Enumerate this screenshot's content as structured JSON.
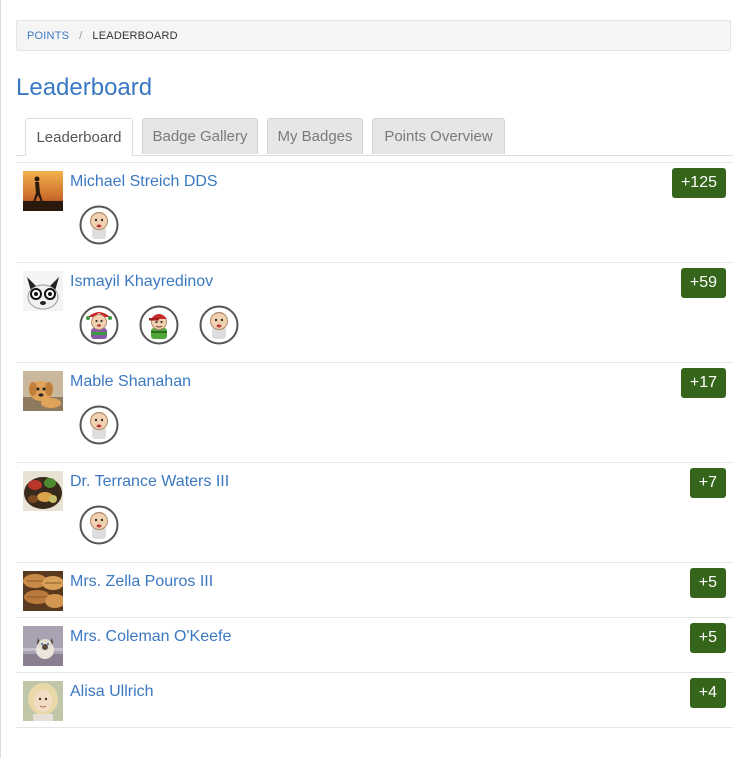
{
  "breadcrumb": {
    "parent": "POINTS",
    "separator": "/",
    "current": "LEADERBOARD"
  },
  "page_title": "Leaderboard",
  "tabs": [
    {
      "label": "Leaderboard",
      "active": true
    },
    {
      "label": "Badge Gallery",
      "active": false
    },
    {
      "label": "My Badges",
      "active": false
    },
    {
      "label": "Points Overview",
      "active": false
    }
  ],
  "colors": {
    "link": "#3b78c2",
    "points_badge": "#35651a"
  },
  "rows": [
    {
      "name": "Michael Streich DDS",
      "points": "+125",
      "avatar_icon": "silhouette-sunset-avatar",
      "badges": [
        "baby-badge-icon"
      ]
    },
    {
      "name": "Ismayil Khayredinov",
      "points": "+59",
      "avatar_icon": "dog-with-glasses-avatar",
      "badges": [
        "jester-badge-icon",
        "cap-kid-badge-icon",
        "baby-badge-icon"
      ]
    },
    {
      "name": "Mable Shanahan",
      "points": "+17",
      "avatar_icon": "puppy-avatar",
      "badges": [
        "baby-badge-icon"
      ]
    },
    {
      "name": "Dr. Terrance Waters III",
      "points": "+7",
      "avatar_icon": "food-plate-avatar",
      "badges": [
        "baby-badge-icon"
      ]
    },
    {
      "name": "Mrs. Zella Pouros III",
      "points": "+5",
      "avatar_icon": "bread-avatar",
      "badges": []
    },
    {
      "name": "Mrs. Coleman O'Keefe",
      "points": "+5",
      "avatar_icon": "siamese-cat-avatar",
      "badges": []
    },
    {
      "name": "Alisa Ullrich",
      "points": "+4",
      "avatar_icon": "girl-portrait-avatar",
      "badges": []
    }
  ]
}
